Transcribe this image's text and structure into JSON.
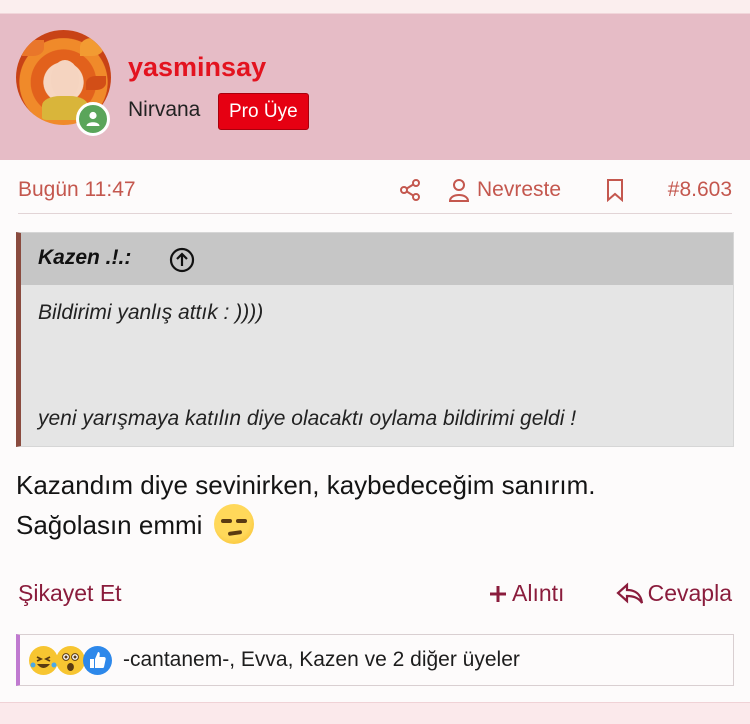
{
  "user": {
    "name": "yasminsay",
    "title": "Nirvana",
    "badge": "Pro Üye"
  },
  "meta": {
    "time": "Bugün 11:47",
    "nevreste_label": "Nevreste",
    "post_number": "#8.603"
  },
  "quote": {
    "author": "Kazen .!.:",
    "line1": "Bildirimi yanlış attık : ))))",
    "line2": "yeni yarışmaya katılın diye olacaktı oylama bildirimi geldi !"
  },
  "message": {
    "line1": "Kazandım diye sevinirken, kaybedeceğim sanırım.",
    "line2": "Sağolasın emmi"
  },
  "actions": {
    "report": "Şikayet Et",
    "quote": "Alıntı",
    "reply": "Cevapla"
  },
  "reactions": {
    "icons": [
      "laughing-tears-emoji",
      "astonished-emoji",
      "like-thumb"
    ],
    "summary": "-cantanem-, Evva, Kazen ve 2 diğer üyeler"
  },
  "colors": {
    "username": "#e3131f",
    "badge": "#e60012",
    "header_bg": "#e6bcc6",
    "link": "#8a1c3c",
    "meta": "#c4574e",
    "quote_border": "#8a4b3f",
    "reaction_border": "#c07ad0"
  }
}
